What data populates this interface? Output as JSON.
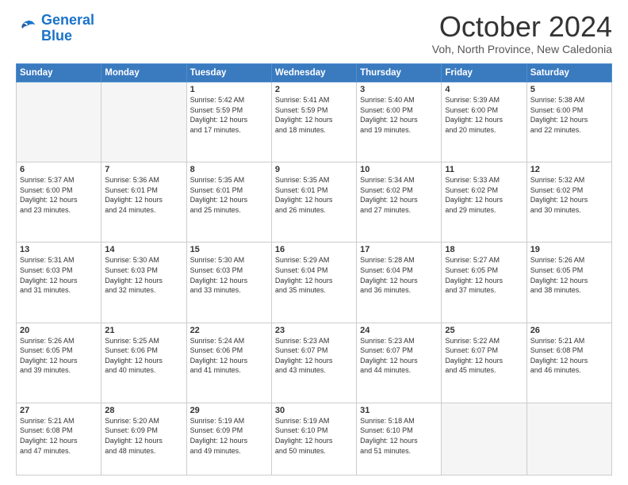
{
  "header": {
    "logo_line1": "General",
    "logo_line2": "Blue",
    "month": "October 2024",
    "location": "Voh, North Province, New Caledonia"
  },
  "weekdays": [
    "Sunday",
    "Monday",
    "Tuesday",
    "Wednesday",
    "Thursday",
    "Friday",
    "Saturday"
  ],
  "weeks": [
    [
      {
        "day": "",
        "empty": true
      },
      {
        "day": "",
        "empty": true
      },
      {
        "day": "1",
        "sunrise": "5:42 AM",
        "sunset": "5:59 PM",
        "daylight": "12 hours and 17 minutes."
      },
      {
        "day": "2",
        "sunrise": "5:41 AM",
        "sunset": "5:59 PM",
        "daylight": "12 hours and 18 minutes."
      },
      {
        "day": "3",
        "sunrise": "5:40 AM",
        "sunset": "6:00 PM",
        "daylight": "12 hours and 19 minutes."
      },
      {
        "day": "4",
        "sunrise": "5:39 AM",
        "sunset": "6:00 PM",
        "daylight": "12 hours and 20 minutes."
      },
      {
        "day": "5",
        "sunrise": "5:38 AM",
        "sunset": "6:00 PM",
        "daylight": "12 hours and 22 minutes."
      }
    ],
    [
      {
        "day": "6",
        "sunrise": "5:37 AM",
        "sunset": "6:00 PM",
        "daylight": "12 hours and 23 minutes."
      },
      {
        "day": "7",
        "sunrise": "5:36 AM",
        "sunset": "6:01 PM",
        "daylight": "12 hours and 24 minutes."
      },
      {
        "day": "8",
        "sunrise": "5:35 AM",
        "sunset": "6:01 PM",
        "daylight": "12 hours and 25 minutes."
      },
      {
        "day": "9",
        "sunrise": "5:35 AM",
        "sunset": "6:01 PM",
        "daylight": "12 hours and 26 minutes."
      },
      {
        "day": "10",
        "sunrise": "5:34 AM",
        "sunset": "6:02 PM",
        "daylight": "12 hours and 27 minutes."
      },
      {
        "day": "11",
        "sunrise": "5:33 AM",
        "sunset": "6:02 PM",
        "daylight": "12 hours and 29 minutes."
      },
      {
        "day": "12",
        "sunrise": "5:32 AM",
        "sunset": "6:02 PM",
        "daylight": "12 hours and 30 minutes."
      }
    ],
    [
      {
        "day": "13",
        "sunrise": "5:31 AM",
        "sunset": "6:03 PM",
        "daylight": "12 hours and 31 minutes."
      },
      {
        "day": "14",
        "sunrise": "5:30 AM",
        "sunset": "6:03 PM",
        "daylight": "12 hours and 32 minutes."
      },
      {
        "day": "15",
        "sunrise": "5:30 AM",
        "sunset": "6:03 PM",
        "daylight": "12 hours and 33 minutes."
      },
      {
        "day": "16",
        "sunrise": "5:29 AM",
        "sunset": "6:04 PM",
        "daylight": "12 hours and 35 minutes."
      },
      {
        "day": "17",
        "sunrise": "5:28 AM",
        "sunset": "6:04 PM",
        "daylight": "12 hours and 36 minutes."
      },
      {
        "day": "18",
        "sunrise": "5:27 AM",
        "sunset": "6:05 PM",
        "daylight": "12 hours and 37 minutes."
      },
      {
        "day": "19",
        "sunrise": "5:26 AM",
        "sunset": "6:05 PM",
        "daylight": "12 hours and 38 minutes."
      }
    ],
    [
      {
        "day": "20",
        "sunrise": "5:26 AM",
        "sunset": "6:05 PM",
        "daylight": "12 hours and 39 minutes."
      },
      {
        "day": "21",
        "sunrise": "5:25 AM",
        "sunset": "6:06 PM",
        "daylight": "12 hours and 40 minutes."
      },
      {
        "day": "22",
        "sunrise": "5:24 AM",
        "sunset": "6:06 PM",
        "daylight": "12 hours and 41 minutes."
      },
      {
        "day": "23",
        "sunrise": "5:23 AM",
        "sunset": "6:07 PM",
        "daylight": "12 hours and 43 minutes."
      },
      {
        "day": "24",
        "sunrise": "5:23 AM",
        "sunset": "6:07 PM",
        "daylight": "12 hours and 44 minutes."
      },
      {
        "day": "25",
        "sunrise": "5:22 AM",
        "sunset": "6:07 PM",
        "daylight": "12 hours and 45 minutes."
      },
      {
        "day": "26",
        "sunrise": "5:21 AM",
        "sunset": "6:08 PM",
        "daylight": "12 hours and 46 minutes."
      }
    ],
    [
      {
        "day": "27",
        "sunrise": "5:21 AM",
        "sunset": "6:08 PM",
        "daylight": "12 hours and 47 minutes."
      },
      {
        "day": "28",
        "sunrise": "5:20 AM",
        "sunset": "6:09 PM",
        "daylight": "12 hours and 48 minutes."
      },
      {
        "day": "29",
        "sunrise": "5:19 AM",
        "sunset": "6:09 PM",
        "daylight": "12 hours and 49 minutes."
      },
      {
        "day": "30",
        "sunrise": "5:19 AM",
        "sunset": "6:10 PM",
        "daylight": "12 hours and 50 minutes."
      },
      {
        "day": "31",
        "sunrise": "5:18 AM",
        "sunset": "6:10 PM",
        "daylight": "12 hours and 51 minutes."
      },
      {
        "day": "",
        "empty": true
      },
      {
        "day": "",
        "empty": true
      }
    ]
  ]
}
